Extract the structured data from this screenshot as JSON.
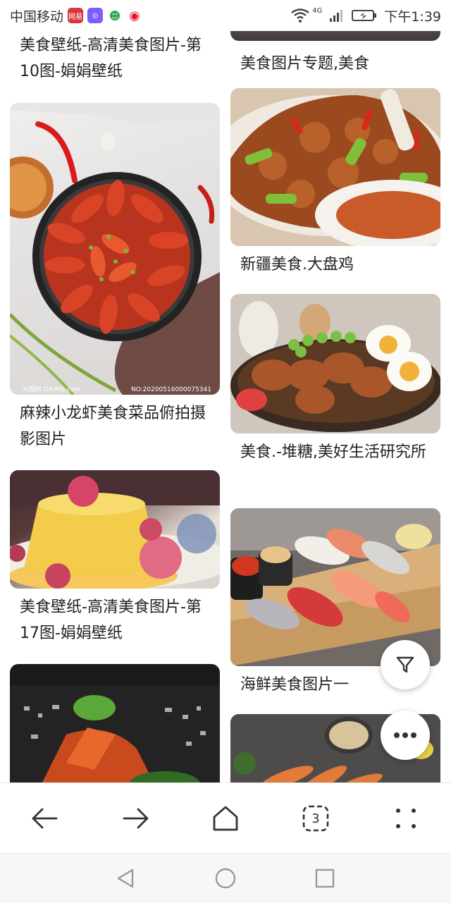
{
  "status_bar": {
    "carrier": "中国移动",
    "network": "4G",
    "time": "下午1:39",
    "app_icon_netease": "网易"
  },
  "feed": {
    "left": [
      {
        "caption": "美食壁纸-高清美食图片-第10图-娟娟壁纸"
      },
      {
        "caption": "麻辣小龙虾美食菜品俯拍摄影图片",
        "watermark_left": "大图网 DAIMG.com",
        "watermark_right": "NO:20200516000075341"
      },
      {
        "caption": "美食壁纸-高清美食图片-第17图-娟娟壁纸"
      },
      {
        "caption": ""
      }
    ],
    "right": [
      {
        "caption": "美食图片专题,美食"
      },
      {
        "caption": "新疆美食.大盘鸡"
      },
      {
        "caption": "美食.-堆糖,美好生活研究所"
      },
      {
        "caption": "海鲜美食图片一"
      },
      {
        "caption": ""
      }
    ]
  },
  "nav": {
    "back": "back-arrow-icon",
    "forward": "forward-arrow-icon",
    "home": "home-icon",
    "tab_count": "3",
    "menu": "grid-dots-icon"
  },
  "colors": {
    "accent": "#ffffff",
    "text": "#222222"
  }
}
